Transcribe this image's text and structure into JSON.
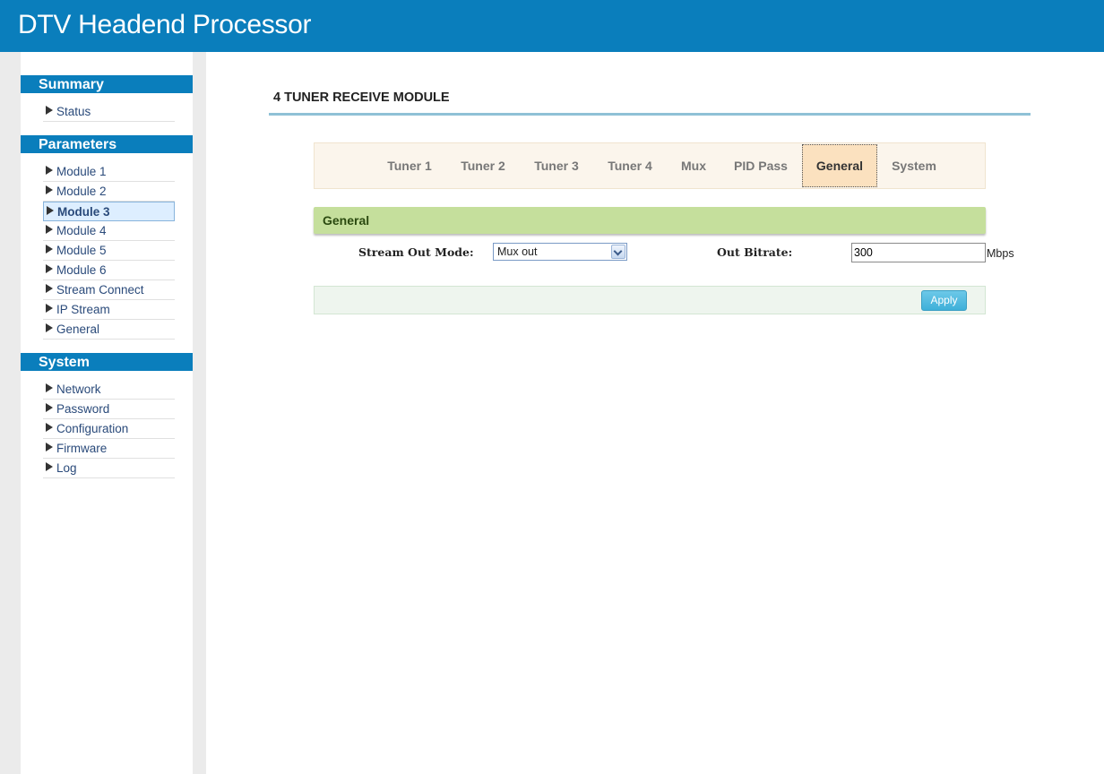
{
  "header": {
    "title": "DTV Headend Processor"
  },
  "sidebar": {
    "summary_title": "Summary",
    "summary_items": [
      {
        "label": "Status"
      }
    ],
    "parameters_title": "Parameters",
    "parameters_items": [
      {
        "label": "Module 1"
      },
      {
        "label": "Module 2"
      },
      {
        "label": "Module 3",
        "active": true
      },
      {
        "label": "Module 4"
      },
      {
        "label": "Module 5"
      },
      {
        "label": "Module 6"
      },
      {
        "label": "Stream Connect"
      },
      {
        "label": "IP Stream"
      },
      {
        "label": "General"
      }
    ],
    "system_title": "System",
    "system_items": [
      {
        "label": "Network"
      },
      {
        "label": "Password"
      },
      {
        "label": "Configuration"
      },
      {
        "label": "Firmware"
      },
      {
        "label": "Log"
      }
    ]
  },
  "main": {
    "page_title": "4 TUNER RECEIVE MODULE",
    "tabs": [
      {
        "label": "Tuner 1"
      },
      {
        "label": "Tuner 2"
      },
      {
        "label": "Tuner 3"
      },
      {
        "label": "Tuner 4"
      },
      {
        "label": "Mux"
      },
      {
        "label": "PID Pass"
      },
      {
        "label": "General",
        "active": true
      },
      {
        "label": "System"
      }
    ],
    "section_title": "General",
    "stream_out_mode": {
      "label": "Stream Out Mode:",
      "value": "Mux out"
    },
    "out_bitrate": {
      "label": "Out Bitrate:",
      "value": "300",
      "unit": "Mbps"
    },
    "apply_label": "Apply"
  },
  "colors": {
    "header_bg": "#0a7ebc",
    "section_bar": "#c5df9c",
    "active_tab": "#fbe1bf",
    "apply_button": "#4ab8df"
  }
}
